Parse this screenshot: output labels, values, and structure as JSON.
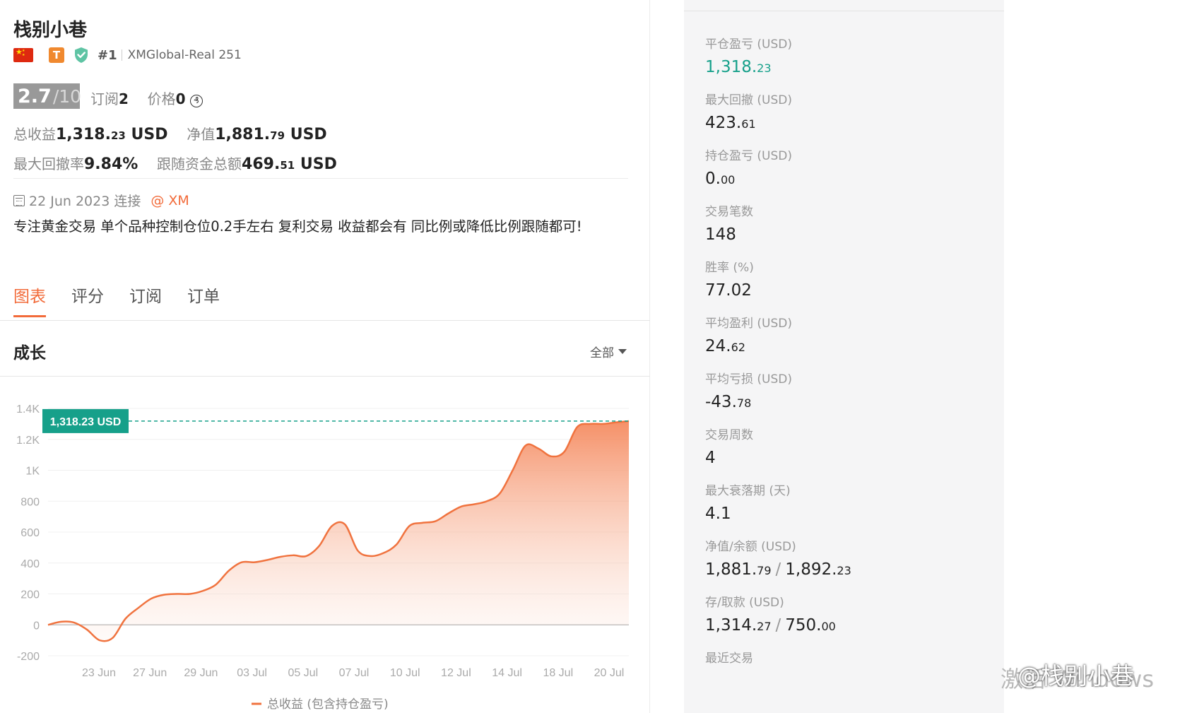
{
  "profile": {
    "name": "栈别小巷",
    "tier_badge": "T",
    "rank": "#1",
    "account": "XMGlobal-Real 251"
  },
  "score": {
    "value": "2.7",
    "max": "/10"
  },
  "subscription": {
    "label": "订阅",
    "count": "2",
    "price_label": "价格",
    "price": "0",
    "coin": "₰"
  },
  "metrics": {
    "total_profit_label": "总收益",
    "total_profit_int": "1,318.",
    "total_profit_dec": "23",
    "total_profit_unit": "USD",
    "equity_label": "净值",
    "equity_int": "1,881.",
    "equity_dec": "79",
    "equity_unit": "USD",
    "max_dd_label": "最大回撤率",
    "max_dd": "9.84%",
    "follow_funds_label": "跟随资金总额",
    "follow_funds_int": "469.",
    "follow_funds_dec": "51",
    "follow_funds_unit": "USD"
  },
  "connection": {
    "date": "22 Jun 2023 连接",
    "broker": "@ XM"
  },
  "description": "专注黄金交易 单个品种控制仓位0.2手左右  复利交易 收益都会有 同比例或降低比例跟随都可!",
  "tabs": [
    {
      "label": "图表",
      "active": true
    },
    {
      "label": "评分"
    },
    {
      "label": "订阅"
    },
    {
      "label": "订单"
    }
  ],
  "growth": {
    "title": "成长",
    "filter": "全部"
  },
  "colors": {
    "accent": "#f26b3a",
    "green": "#16a08a",
    "line": "#f0733f"
  },
  "chart_data": {
    "type": "area",
    "y_ticks": [
      "1.4K",
      "1.2K",
      "1K",
      "800",
      "600",
      "400",
      "200",
      "0",
      "-200"
    ],
    "ylim": [
      -200,
      1400
    ],
    "x_ticks": [
      "23 Jun",
      "27 Jun",
      "29 Jun",
      "03 Jul",
      "05 Jul",
      "07 Jul",
      "10 Jul",
      "12 Jul",
      "14 Jul",
      "18 Jul",
      "20 Jul"
    ],
    "current_label": "1,318.23 USD",
    "current_value": 1318.23,
    "legend": "总收益 (包含持仓盈亏)",
    "series": [
      {
        "name": "总收益 (包含持仓盈亏)",
        "values": [
          0,
          20,
          15,
          -30,
          -100,
          -85,
          40,
          110,
          170,
          195,
          200,
          200,
          220,
          260,
          350,
          405,
          405,
          420,
          440,
          450,
          445,
          510,
          640,
          650,
          480,
          445,
          465,
          520,
          640,
          660,
          670,
          720,
          765,
          780,
          800,
          850,
          1000,
          1160,
          1140,
          1090,
          1120,
          1280,
          1300,
          1300,
          1310,
          1318
        ]
      }
    ]
  },
  "stats": [
    {
      "label": "平仓盈亏 (USD)",
      "int": "1,318.",
      "dec": "23",
      "green": true
    },
    {
      "label": "最大回撤 (USD)",
      "int": "423.",
      "dec": "61"
    },
    {
      "label": "持仓盈亏 (USD)",
      "int": "0.",
      "dec": "00"
    },
    {
      "label": "交易笔数",
      "int": "148",
      "dec": ""
    },
    {
      "label": "胜率 (%)",
      "int": "77.02",
      "dec": ""
    },
    {
      "label": "平均盈利 (USD)",
      "int": "24.",
      "dec": "62"
    },
    {
      "label": "平均亏损 (USD)",
      "int": "-43.",
      "dec": "78"
    },
    {
      "label": "交易周数",
      "int": "4",
      "dec": ""
    },
    {
      "label": "最大衰落期 (天)",
      "int": "4.1",
      "dec": ""
    },
    {
      "label": "净值/余额 (USD)",
      "int": "1,881.",
      "dec": "79",
      "int2": "1,892.",
      "dec2": "23"
    },
    {
      "label": "存/取款 (USD)",
      "int": "1,314.",
      "dec": "27",
      "int2": "750.",
      "dec2": "00"
    },
    {
      "label": "最近交易",
      "int": "",
      "dec": ""
    }
  ],
  "watermark": {
    "activate": "激活 Windows",
    "weibo": "@栈别小巷"
  }
}
